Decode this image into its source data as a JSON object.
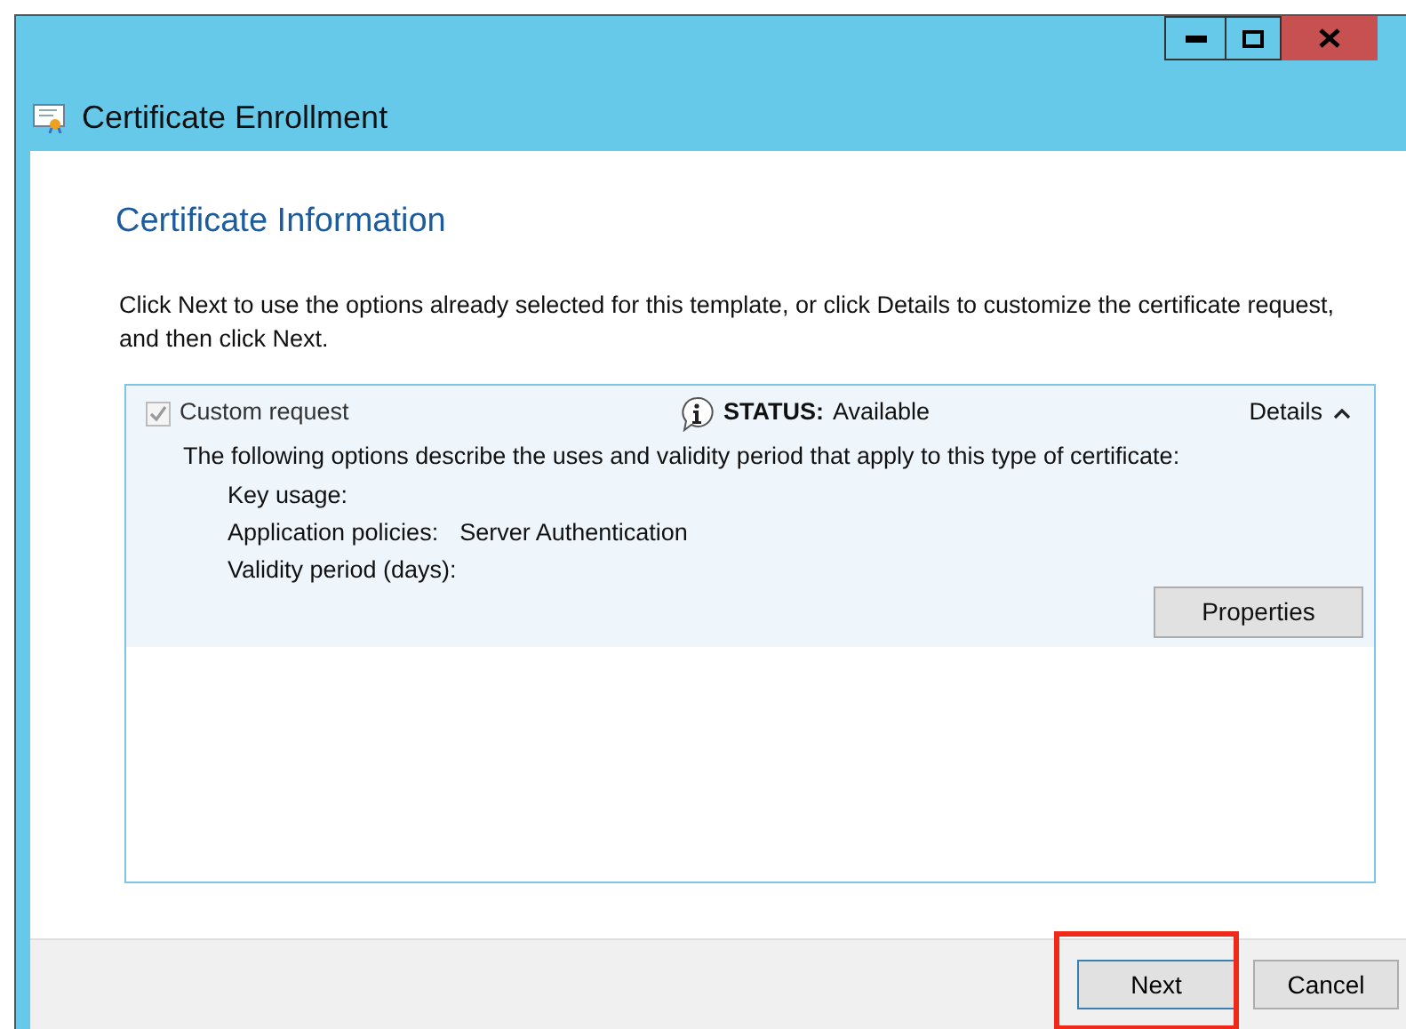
{
  "window": {
    "title": "Certificate Enrollment"
  },
  "heading": "Certificate Information",
  "intro": "Click Next to use the options already selected for this template, or click Details to customize the certificate request, and then click Next.",
  "request": {
    "label": "Custom request",
    "checked": true,
    "disabled": true,
    "status_label": "STATUS:",
    "status": "Available",
    "details": "Details",
    "expanded": true,
    "description": "The following options describe the uses and validity period that apply to this type of certificate:",
    "fields": [
      {
        "label": "Key usage:"
      },
      {
        "label": "Application policies:",
        "value": "Server Authentication"
      },
      {
        "label": "Validity period (days):"
      }
    ],
    "properties_button": "Properties"
  },
  "buttons": [
    {
      "label": "Next",
      "highlighted": true
    },
    {
      "label": "Cancel",
      "highlighted": false
    }
  ]
}
